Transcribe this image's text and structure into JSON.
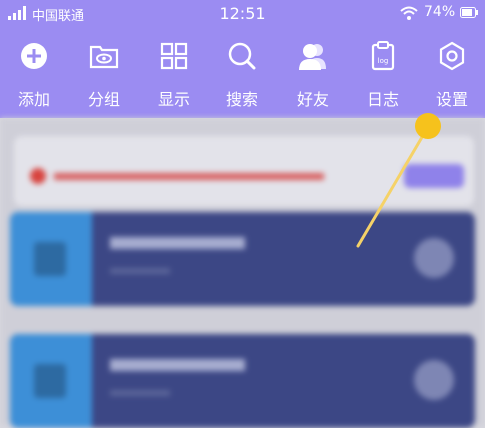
{
  "status_bar": {
    "carrier": "中国联通",
    "time": "12:51",
    "battery": "74%"
  },
  "toolbar": {
    "items": [
      {
        "label": "添加",
        "icon": "plus-circle-icon"
      },
      {
        "label": "分组",
        "icon": "folder-eye-icon"
      },
      {
        "label": "显示",
        "icon": "grid-icon"
      },
      {
        "label": "搜索",
        "icon": "search-icon"
      },
      {
        "label": "好友",
        "icon": "friends-icon"
      },
      {
        "label": "日志",
        "icon": "log-clipboard-icon"
      },
      {
        "label": "设置",
        "icon": "hexagon-settings-icon"
      }
    ]
  },
  "colors": {
    "header": "#9b8cf2",
    "card": "#3c4785",
    "pointer": "#f6c21c"
  }
}
